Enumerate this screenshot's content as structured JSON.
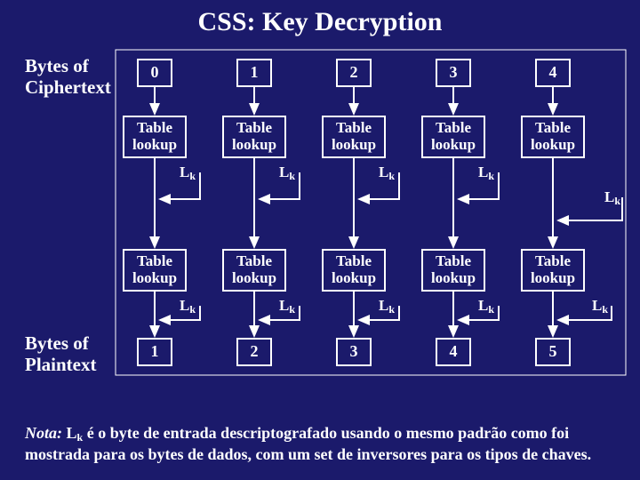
{
  "title": "CSS: Key Decryption",
  "labels": {
    "bytes_of": "Bytes of",
    "ciphertext": "Ciphertext",
    "plaintext": "Plaintext"
  },
  "table_lookup_label": "Table\nlookup",
  "lk_label_main": "L",
  "lk_label_sub": "k",
  "top_numbers": [
    "0",
    "1",
    "2",
    "3",
    "4"
  ],
  "bottom_numbers": [
    "1",
    "2",
    "3",
    "4",
    "5"
  ],
  "footnote": {
    "nota": "Nota:",
    "rest": " é o byte de entrada descriptografado usando o mesmo padrão como foi mostrada para os bytes de dados, com um set de inversores para os tipos de chaves."
  },
  "chart_data": {
    "type": "diagram",
    "title": "CSS: Key Decryption",
    "columns": 5,
    "input_label": "Bytes of Ciphertext",
    "output_label": "Bytes of Plaintext",
    "input_indices": [
      0,
      1,
      2,
      3,
      4
    ],
    "output_indices": [
      1,
      2,
      3,
      4,
      5
    ],
    "stage_label": "Table lookup",
    "stage_count_per_column": 2,
    "side_input_symbol": "Lk",
    "side_input_note": "Lk: decrypted input byte (same pattern as data bytes, with inverters for key types)",
    "lk_side_inputs": {
      "stage1": [
        1,
        2,
        3,
        4
      ],
      "stage1_extra_right": true,
      "stage2": [
        1,
        2,
        3,
        4,
        5
      ]
    },
    "flow": "Each ciphertext byte i feeds a Table lookup (stage 1); its output plus Lk feeds a second Table lookup (stage 2); stage 2 output is plaintext byte i+1."
  }
}
